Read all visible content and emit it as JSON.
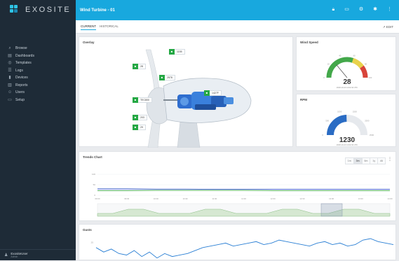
{
  "brand": {
    "name": "EXOSITE"
  },
  "nav": [
    {
      "label": "Browse",
      "icon": "search-icon"
    },
    {
      "label": "Dashboards",
      "icon": "dashboard-icon"
    },
    {
      "label": "Templates",
      "icon": "template-icon"
    },
    {
      "label": "Logs",
      "icon": "log-icon"
    },
    {
      "label": "Devices",
      "icon": "device-icon"
    },
    {
      "label": "Reports",
      "icon": "report-icon"
    },
    {
      "label": "Users",
      "icon": "users-icon"
    },
    {
      "label": "Setup",
      "icon": "setup-icon"
    }
  ],
  "user": {
    "name": "ExositeUser",
    "role": "Admin"
  },
  "header": {
    "title": "Wind Turbine - 01"
  },
  "tabs": [
    {
      "label": "CURRENT"
    },
    {
      "label": "HISTORICAL"
    }
  ],
  "edit_label": "↗ EDIT",
  "overlay": {
    "title": "Overlay",
    "tags": [
      {
        "value": "1155"
      },
      {
        "value": "28"
      },
      {
        "value": "2578"
      },
      {
        "value": "1427F"
      },
      {
        "value": "TEC800"
      },
      {
        "value": "203"
      },
      {
        "value": "29"
      }
    ]
  },
  "wind_speed": {
    "title": "Wind Speed",
    "value": "28",
    "level": 0.28,
    "date": "2018-10-10 14:02:43 UTC",
    "ticks": [
      "0",
      "20",
      "40",
      "60",
      "80",
      "100"
    ]
  },
  "rpm": {
    "title": "RPM",
    "value": "1230",
    "level": 0.49,
    "date": "2018-10-10 14:02:43 UTC",
    "ticks": [
      "0",
      "500",
      "1000",
      "1500",
      "2000",
      "2500"
    ]
  },
  "trends": {
    "title": "Trends Chart",
    "ranges": [
      "1m",
      "3m",
      "6m",
      "1y",
      "All"
    ],
    "active_range": "3m",
    "y_ticks": [
      "100",
      "50",
      "0"
    ],
    "x_ticks": [
      "09:00",
      "09:30",
      "10:00",
      "10:30",
      "11:00",
      "11:30",
      "12:00",
      "12:30",
      "13:00",
      "13:30",
      "14:00"
    ],
    "colors": {
      "series_a": "#2a4fc4",
      "series_b": "#3aa54a"
    }
  },
  "chart_data": [
    {
      "type": "line",
      "title": "Trends Chart",
      "xlabel": "",
      "ylabel": "",
      "x": [
        "09:00",
        "09:30",
        "10:00",
        "10:30",
        "11:00",
        "11:30",
        "12:00",
        "12:30",
        "13:00",
        "13:30",
        "14:00"
      ],
      "series": [
        {
          "values": [
            30,
            30,
            29,
            29,
            28,
            28,
            28,
            28,
            28,
            28,
            28
          ]
        },
        {
          "values": [
            22,
            22,
            23,
            23,
            23,
            23,
            22,
            22,
            22,
            22,
            22
          ]
        }
      ],
      "ylim": [
        0,
        100
      ],
      "grid": true,
      "legend": "none"
    },
    {
      "type": "line",
      "title": "Gusts",
      "series": [
        {
          "values": [
            18,
            12,
            16,
            10,
            8,
            14,
            6,
            12,
            4,
            10,
            6,
            8,
            10,
            14,
            18,
            20,
            22,
            24,
            20,
            22,
            24,
            26,
            22,
            24,
            28,
            26,
            24,
            22,
            20,
            24,
            26,
            22,
            24,
            20,
            22,
            28,
            30,
            26,
            24,
            22
          ]
        }
      ],
      "ylim": [
        0,
        30
      ],
      "grid": false,
      "legend": "none"
    }
  ],
  "gusts": {
    "title": "Gusts",
    "y_tick": "25"
  }
}
